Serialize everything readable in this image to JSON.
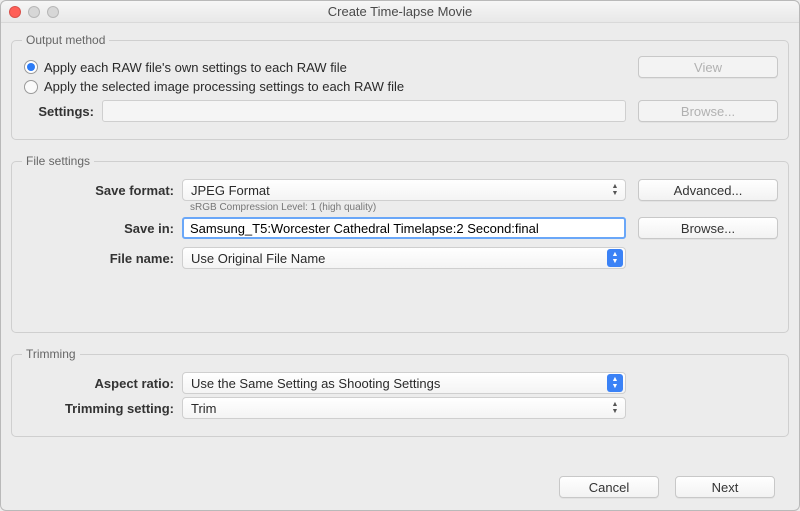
{
  "window": {
    "title": "Create Time-lapse Movie"
  },
  "sections": {
    "output": {
      "legend": "Output method",
      "radio1": "Apply each RAW file's own settings to each RAW file",
      "radio2": "Apply the selected image processing settings to each RAW file",
      "settings_label": "Settings:",
      "settings_value": "",
      "view_btn": "View",
      "browse_btn": "Browse..."
    },
    "file": {
      "legend": "File settings",
      "save_format_label": "Save format:",
      "save_format_value": "JPEG Format",
      "save_format_help": "sRGB Compression Level: 1 (high quality)",
      "advanced_btn": "Advanced...",
      "save_in_label": "Save in:",
      "save_in_value": "Samsung_T5:Worcester Cathedral Timelapse:2 Second:final",
      "browse_btn": "Browse...",
      "file_name_label": "File name:",
      "file_name_value": "Use Original File Name"
    },
    "trimming": {
      "legend": "Trimming",
      "aspect_label": "Aspect ratio:",
      "aspect_value": "Use the Same Setting as Shooting Settings",
      "trim_label": "Trimming setting:",
      "trim_value": "Trim"
    }
  },
  "footer": {
    "cancel": "Cancel",
    "next": "Next"
  }
}
